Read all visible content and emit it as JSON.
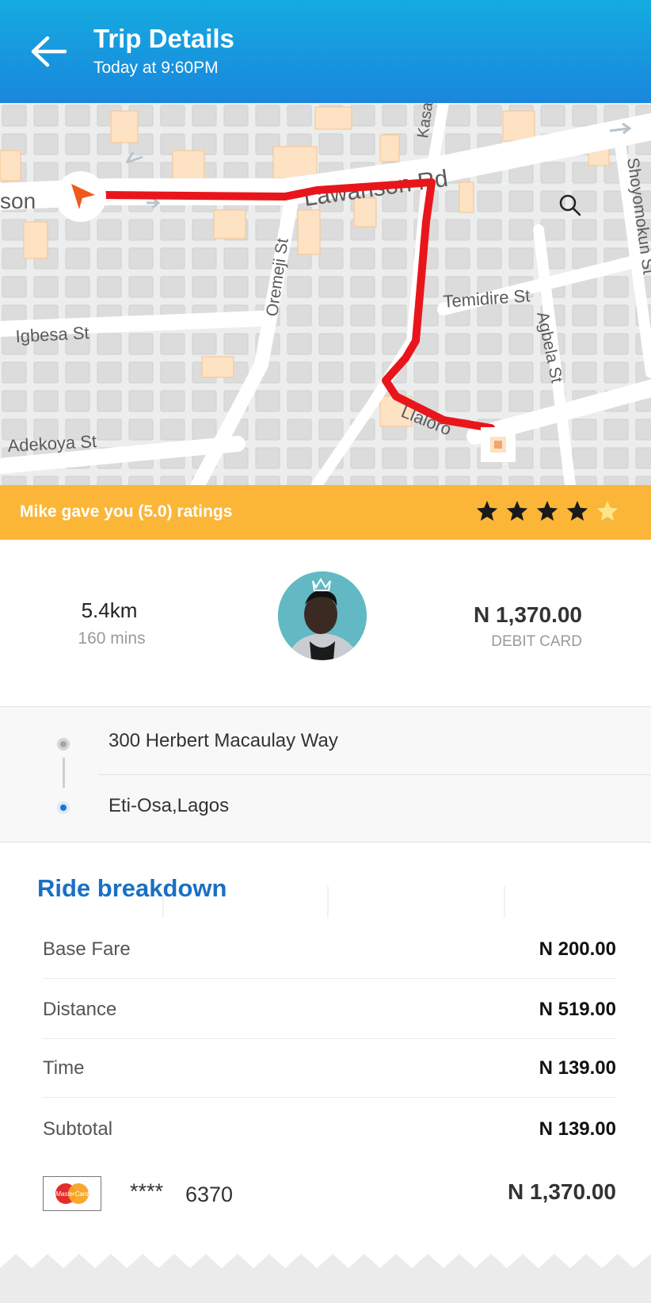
{
  "header": {
    "title": "Trip Details",
    "subtitle": "Today at 9:60PM",
    "back_icon": "arrow-left-icon"
  },
  "map": {
    "street_labels": [
      "Lawanson Rd",
      "Oremeji St",
      "Igbesa St",
      "Temidire St",
      "Agbela St",
      "Adekoya St",
      "Shoyomokun St",
      "Kasa",
      "son",
      "Llaloro"
    ],
    "route_color": "#e8161c",
    "search_icon": "search-icon",
    "origin_icon": "navigation-arrow-icon",
    "destination_icon": "destination-marker-icon"
  },
  "rating": {
    "text": "Mike gave you (5.0) ratings",
    "value": 5.0,
    "max": 5
  },
  "trip": {
    "distance": "5.4km",
    "duration": "160 mins",
    "amount": "N 1,370.00",
    "payment_type": "DEBIT CARD"
  },
  "addresses": {
    "pickup": "300 Herbert Macaulay Way",
    "dropoff": "Eti-Osa,Lagos"
  },
  "breakdown": {
    "title": "Ride breakdown",
    "rows": [
      {
        "label": "Base Fare",
        "value": "N 200.00"
      },
      {
        "label": "Distance",
        "value": "N 519.00"
      },
      {
        "label": "Time",
        "value": "N 139.00"
      },
      {
        "label": "Subtotal",
        "value": "N 139.00"
      }
    ],
    "card": {
      "brand": "MasterCard",
      "masked": "****",
      "last4": "6370",
      "total": "N 1,370.00"
    }
  },
  "colors": {
    "header_top": "#14ace0",
    "header_bottom": "#1a86dc",
    "rating_bar": "#fbb637",
    "accent_blue": "#1a6fc4",
    "route_red": "#e8161c"
  }
}
